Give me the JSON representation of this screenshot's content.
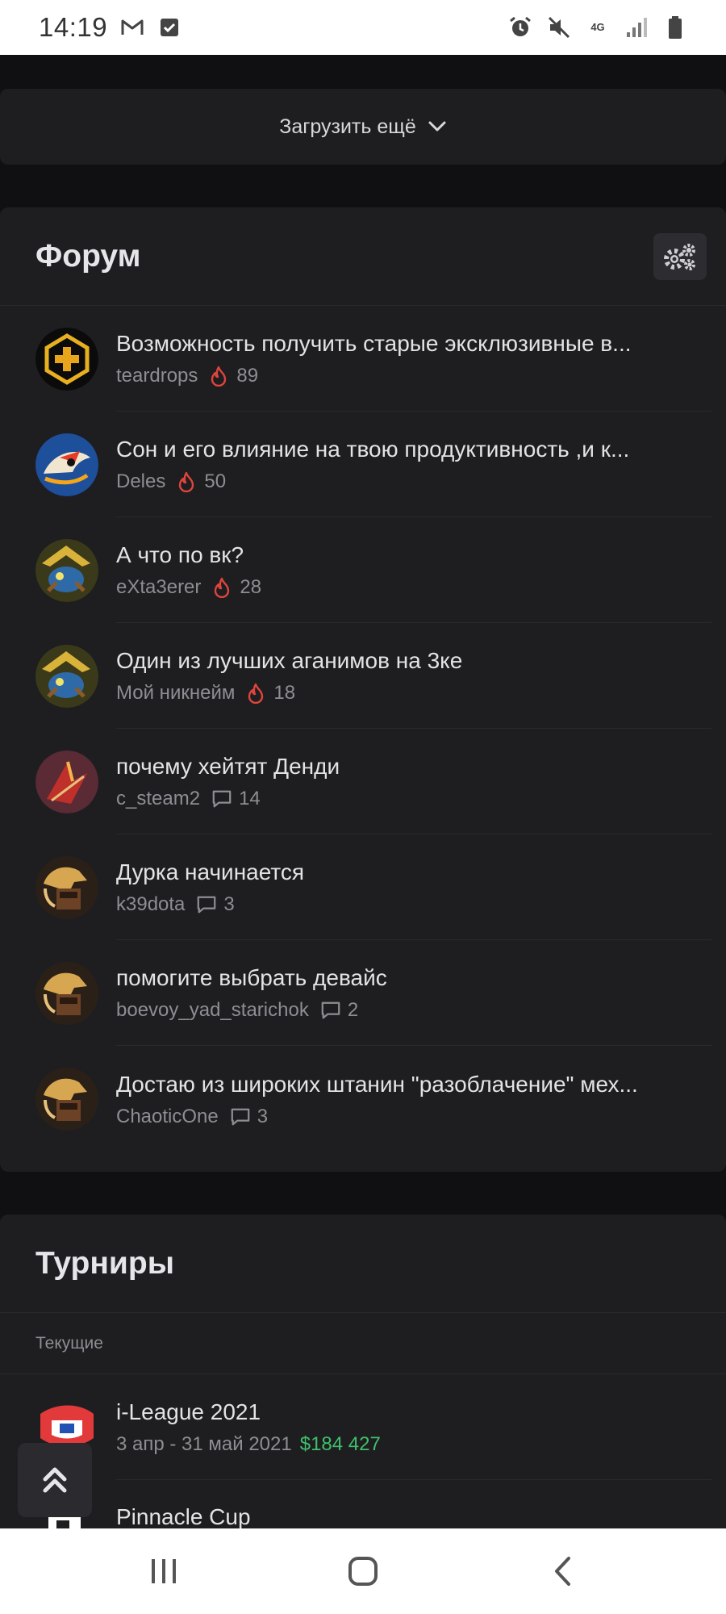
{
  "status_bar": {
    "time": "14:19",
    "network": "4G"
  },
  "load_more": {
    "label": "Загрузить ещё"
  },
  "forum": {
    "title": "Форум",
    "topics": [
      {
        "title": "Возможность получить старые эксклюзивные в...",
        "author": "teardrops",
        "icon": "fire-icon",
        "count": "89"
      },
      {
        "title": "Сон и его влияние на твою продуктивность ,и к...",
        "author": "Deles",
        "icon": "fire-icon",
        "count": "50"
      },
      {
        "title": "А что по вк?",
        "author": "eXta3erer",
        "icon": "fire-icon",
        "count": "28"
      },
      {
        "title": "Один из лучших аганимов на 3ке",
        "author": "Мой никнейм",
        "icon": "fire-icon",
        "count": "18"
      },
      {
        "title": "почему хейтят Денди",
        "author": "c_steam2",
        "icon": "comment-icon",
        "count": "14"
      },
      {
        "title": "Дурка начинается",
        "author": "k39dota",
        "icon": "comment-icon",
        "count": "3"
      },
      {
        "title": "помогите выбрать девайс",
        "author": "boevoy_yad_starichok",
        "icon": "comment-icon",
        "count": "2"
      },
      {
        "title": "Достаю из широких штанин \"разоблачение\" мех...",
        "author": "ChaoticOne",
        "icon": "comment-icon",
        "count": "3"
      }
    ]
  },
  "tournaments": {
    "title": "Турниры",
    "section_label": "Текущие",
    "items": [
      {
        "name": "i-League 2021",
        "dates": "3 апр - 31 май 2021",
        "prize": "$184 427"
      },
      {
        "name": "Pinnacle Cup",
        "dates": "",
        "prize": ""
      }
    ]
  },
  "colors": {
    "background": "#101012",
    "card": "#1e1e21",
    "fire": "#e0443c",
    "prize": "#3fbf6a"
  }
}
